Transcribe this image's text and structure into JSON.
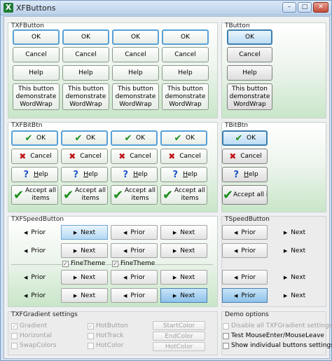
{
  "window": {
    "title": "XFButtons",
    "minimize": "–",
    "maximize": "□",
    "close": "✕",
    "app_icon_letter": "X"
  },
  "icons": {
    "ok": "check-icon",
    "cancel": "cross-icon",
    "help": "question-icon",
    "accept": "big-check-icon",
    "prior": "left-triangle-icon",
    "next": "right-triangle-icon"
  },
  "txfbutton": {
    "caption": "TXFButton",
    "ok": "OK",
    "cancel": "Cancel",
    "help": "Help",
    "wrap_line1": "This button",
    "wrap_line2": "demonstrate",
    "wrap_line3": "WordWrap"
  },
  "tbutton": {
    "caption": "TButton",
    "ok": "OK",
    "cancel": "Cancel",
    "help": "Help",
    "wrap_line1": "This button",
    "wrap_line2": "demonstrate",
    "wrap_line3": "WordWrap"
  },
  "txfbitbtn": {
    "caption": "TXFBitBtn",
    "ok": "OK",
    "cancel": "Cancel",
    "help_prefix": "",
    "help_underlined": "H",
    "help_rest": "elp",
    "accept_line1": "Accept all",
    "accept_line2": "items"
  },
  "tbitbtn": {
    "caption": "TBitBtn",
    "ok": "OK",
    "cancel": "Cancel",
    "help_underlined": "H",
    "help_rest": "elp",
    "accept": "Accept all items"
  },
  "txfspeedbutton": {
    "caption": "TXFSpeedButton",
    "prior": "Prior",
    "next": "Next",
    "finetheme": "FineTheme"
  },
  "tspeedbutton": {
    "caption": "TSpeedButton",
    "prior": "Prior",
    "next": "Next"
  },
  "gradient_settings": {
    "caption": "TXFGradient settings",
    "gradient": "Gradient",
    "horizontal": "Horizontal",
    "swapcolors": "SwapColors",
    "hotbutton": "HotButton",
    "hottrack": "HotTrack",
    "hotcolor": "HotColor",
    "startcolor": "StartColor",
    "endcolor": "EndColor",
    "hotcolor_btn": "HotColor",
    "check_mark": "✓"
  },
  "demo_options": {
    "caption": "Demo options",
    "disable_all": "Disable all TXFGradient settings",
    "test_mouse": "Test MouseEnter/MouseLeave",
    "show_individual": "Show individual buttons settings"
  }
}
